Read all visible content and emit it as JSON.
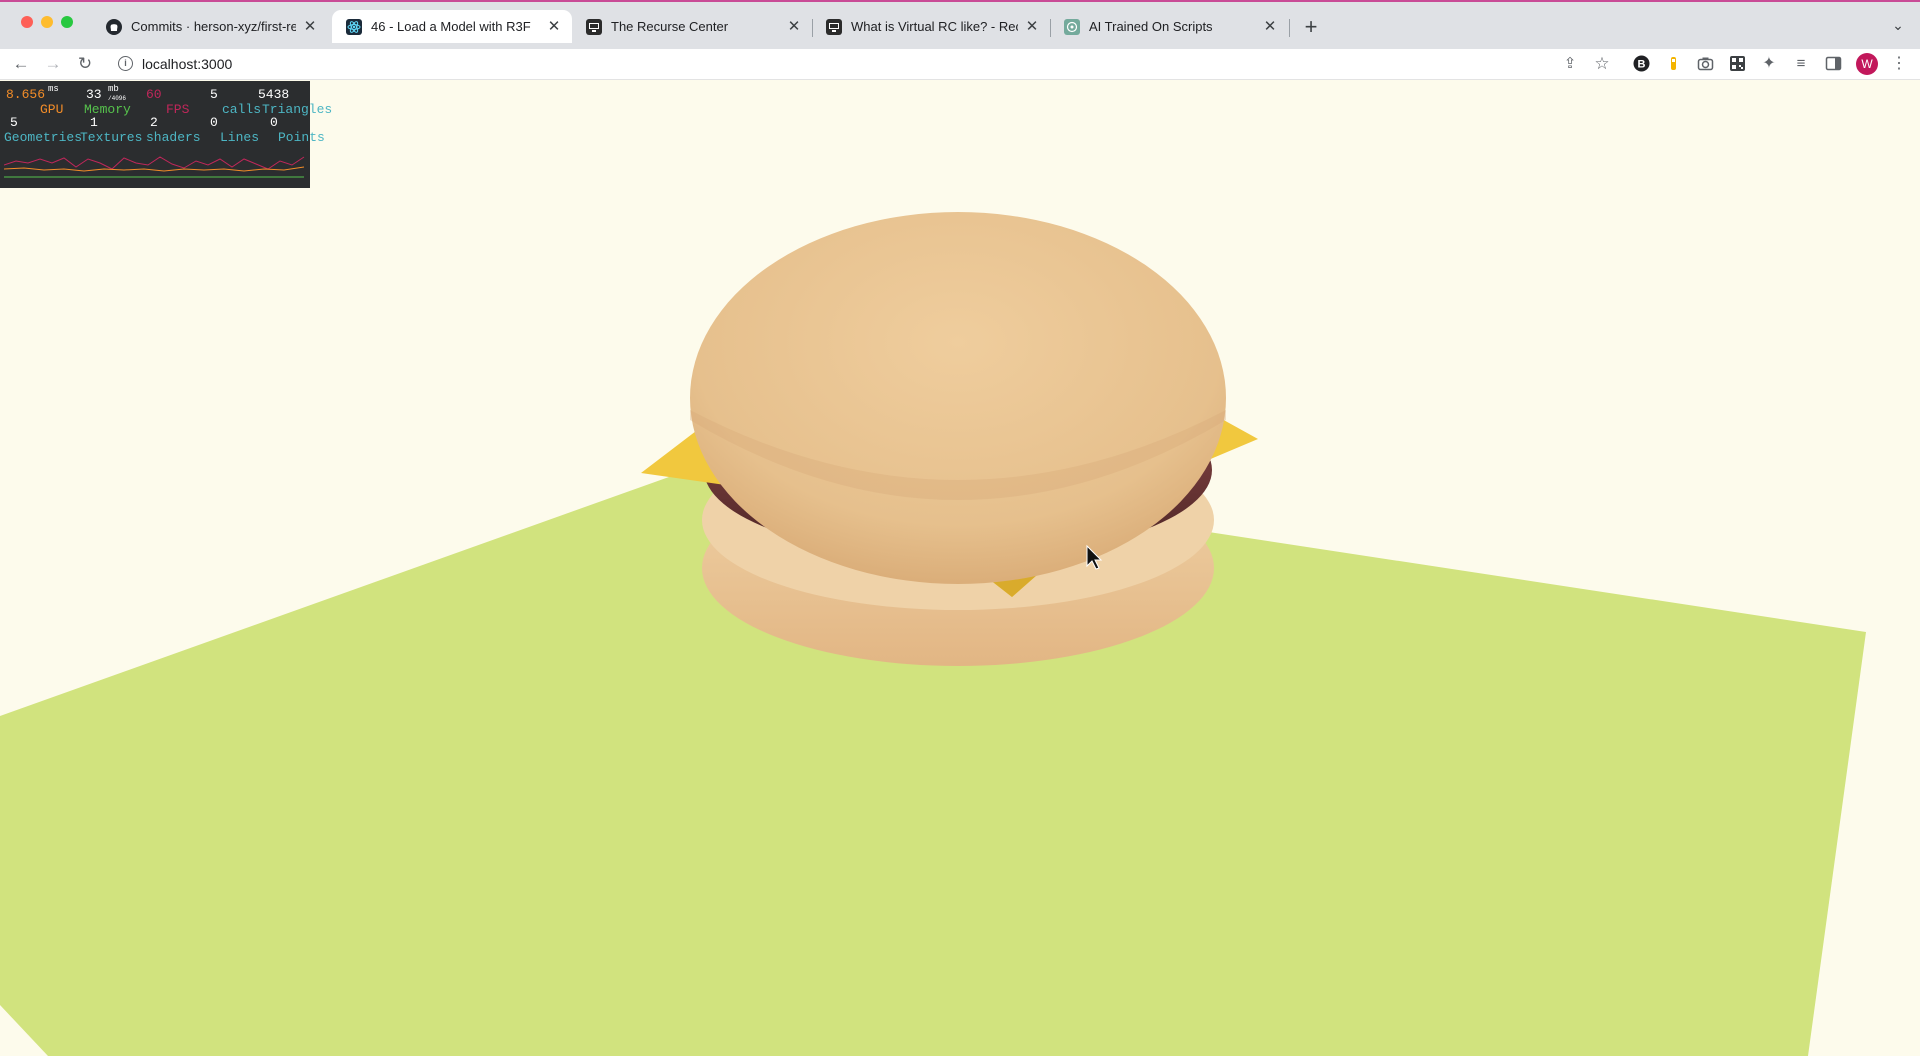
{
  "tabs": [
    {
      "title": "Commits · herson-xyz/first-rea",
      "favicon": "github-icon",
      "active": false
    },
    {
      "title": "46 - Load a Model with R3F",
      "favicon": "react-icon",
      "active": true
    },
    {
      "title": "The Recurse Center",
      "favicon": "recurse-icon",
      "active": false
    },
    {
      "title": "What is Virtual RC like? - Recu",
      "favicon": "recurse-icon",
      "active": false
    },
    {
      "title": "AI Trained On Scripts",
      "favicon": "openai-icon",
      "active": false
    }
  ],
  "toolbar": {
    "url": "localhost:3000",
    "profile_initial": "W"
  },
  "stats": {
    "gpu_value": "8.656",
    "gpu_unit": "ms",
    "gpu_label": "GPU",
    "memory_value": "33",
    "memory_unit": "mb",
    "memory_sub": "/4096",
    "memory_label": "Memory",
    "fps_value": "60",
    "fps_label": "FPS",
    "calls_value": "5",
    "calls_label": "calls",
    "triangles_value": "5438",
    "triangles_label": "Triangles",
    "geometries_value": "5",
    "geometries_label": "Geometries",
    "textures_value": "1",
    "textures_label": "Textures",
    "shaders_value": "2",
    "shaders_label": "shaders",
    "lines_value": "0",
    "lines_label": "Lines",
    "points_value": "0",
    "points_label": "Points"
  },
  "colors": {
    "background": "#fdfbec",
    "floor": "#d1e37e",
    "bun": "#ecc895",
    "patty": "#6a3434",
    "cheese": "#f0c83c",
    "stats_bg": "#2b2d2f"
  }
}
